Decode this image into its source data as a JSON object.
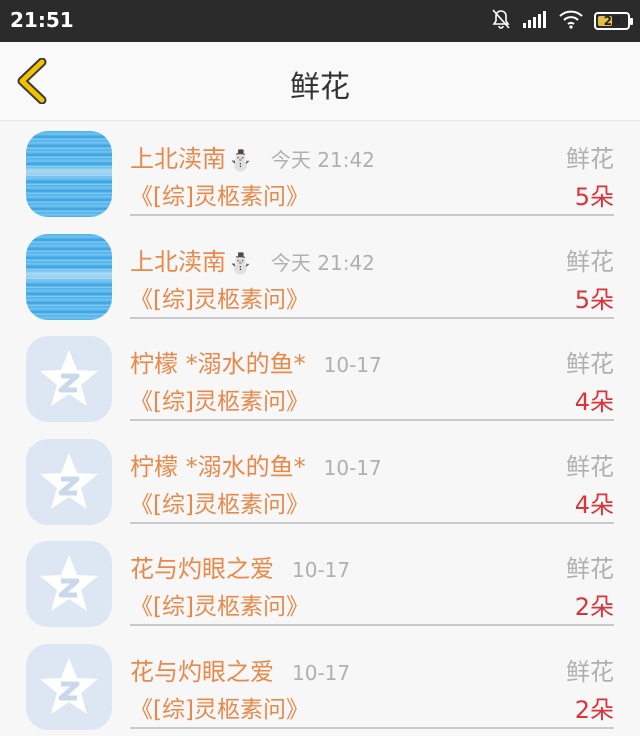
{
  "status_bar": {
    "time": "21:51",
    "battery_level": "29"
  },
  "header": {
    "title": "鲜花"
  },
  "colors": {
    "name": "#e8894a",
    "count": "#d9343a",
    "back_arrow": "#f2c200"
  },
  "rows": [
    {
      "name": "上北渎南",
      "emoji": "⛄",
      "avatar": "sky-icon",
      "date": "今天 21:42",
      "book": "《[综]灵柩素问》",
      "gift": "鲜花",
      "count": "5朵"
    },
    {
      "name": "上北渎南",
      "emoji": "⛄",
      "avatar": "sky-icon",
      "date": "今天 21:42",
      "book": "《[综]灵柩素问》",
      "gift": "鲜花",
      "count": "5朵"
    },
    {
      "name": "柠檬 *溺水的鱼*",
      "emoji": "",
      "avatar": "qq-star-icon",
      "date": "10-17",
      "book": "《[综]灵柩素问》",
      "gift": "鲜花",
      "count": "4朵"
    },
    {
      "name": "柠檬 *溺水的鱼*",
      "emoji": "",
      "avatar": "qq-star-icon",
      "date": "10-17",
      "book": "《[综]灵柩素问》",
      "gift": "鲜花",
      "count": "4朵"
    },
    {
      "name": "花与灼眼之爱",
      "emoji": "",
      "avatar": "qq-star-icon",
      "date": "10-17",
      "book": "《[综]灵柩素问》",
      "gift": "鲜花",
      "count": "2朵"
    },
    {
      "name": "花与灼眼之爱",
      "emoji": "",
      "avatar": "qq-star-icon",
      "date": "10-17",
      "book": "《[综]灵柩素问》",
      "gift": "鲜花",
      "count": "2朵"
    }
  ]
}
